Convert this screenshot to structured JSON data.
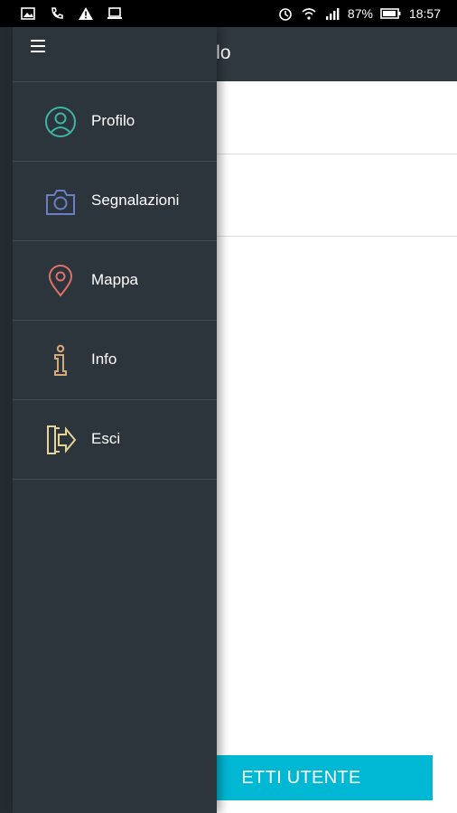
{
  "status_bar": {
    "battery": "87%",
    "time": "18:57",
    "left_icons": [
      "gallery-icon",
      "call-icon",
      "warning-icon",
      "laptop-icon"
    ],
    "right_icons": [
      "alarm-icon",
      "wifi-icon",
      "signal-icon",
      "battery-icon"
    ]
  },
  "app_bar": {
    "title": "rofilo"
  },
  "bottom_button": {
    "label": "ETTI UTENTE"
  },
  "drawer": {
    "items": [
      {
        "label": "Profilo",
        "icon": "user-circle-icon",
        "color": "#3fb3a5"
      },
      {
        "label": "Segnalazioni",
        "icon": "camera-icon",
        "color": "#6b7fc6"
      },
      {
        "label": "Mappa",
        "icon": "map-pin-icon",
        "color": "#e0706a"
      },
      {
        "label": "Info",
        "icon": "info-icon",
        "color": "#d7a77c"
      },
      {
        "label": "Esci",
        "icon": "exit-icon",
        "color": "#e3d59a"
      }
    ]
  },
  "colors": {
    "drawer_bg": "#2b353b",
    "app_bar_bg": "#2f393f",
    "accent": "#00b8d4"
  }
}
